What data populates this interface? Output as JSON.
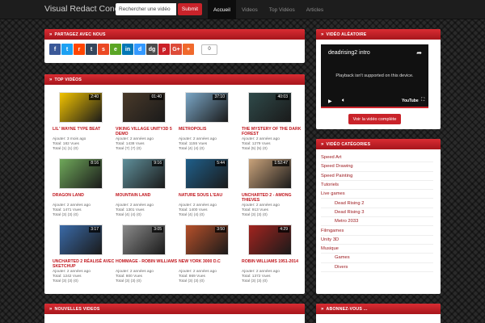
{
  "header": {
    "brand": "Visual Redact Concept",
    "search_placeholder": "Rechercher une vidéo",
    "submit_label": "Submit",
    "nav": [
      {
        "label": "Accueil",
        "active": true
      },
      {
        "label": "Videos",
        "active": false
      },
      {
        "label": "Top Vidéos",
        "active": false
      },
      {
        "label": "Articles",
        "active": false
      }
    ]
  },
  "share_panel": {
    "title": "Partagez avec nous",
    "buttons": [
      {
        "icon": "facebook-icon",
        "glyph": "f",
        "color": "#3b5998"
      },
      {
        "icon": "twitter-icon",
        "glyph": "t",
        "color": "#1da1f2"
      },
      {
        "icon": "reddit-icon",
        "glyph": "r",
        "color": "#ff4500"
      },
      {
        "icon": "tumblr-icon",
        "glyph": "t",
        "color": "#35465c"
      },
      {
        "icon": "stumbleupon-icon",
        "glyph": "s",
        "color": "#eb4924"
      },
      {
        "icon": "evernote-icon",
        "glyph": "e",
        "color": "#5ba525"
      },
      {
        "icon": "linkedin-icon",
        "glyph": "in",
        "color": "#0077b5"
      },
      {
        "icon": "delicious-icon",
        "glyph": "d",
        "color": "#3399ff"
      },
      {
        "icon": "digg-icon",
        "glyph": "dg",
        "color": "#4c4c4c"
      },
      {
        "icon": "pinterest-icon",
        "glyph": "p",
        "color": "#cb2027"
      },
      {
        "icon": "googleplus-icon",
        "glyph": "G+",
        "color": "#dd4b39"
      },
      {
        "icon": "more-share-icon",
        "glyph": "+",
        "color": "#f0692c"
      }
    ],
    "count": "0"
  },
  "top_videos": {
    "title": "Top Vidéos",
    "videos": [
      {
        "title": "LIL' WAYNE TYPE BEAT",
        "duration": "2:40",
        "added": "Ajouter: 3 mois ago",
        "total": "Total: 182 Vues",
        "votes": "Total (1) (1) (0)",
        "thumb": "#f2c300"
      },
      {
        "title": "VIKING VILLAGE UNITY3D 5 DEMO",
        "duration": "01:40",
        "added": "Ajouter: 2 années ago",
        "total": "Total: 1438 Vues",
        "votes": "Total (7) (7) (0)",
        "thumb": "#4a3a2a"
      },
      {
        "title": "METROPOLIS",
        "duration": "37:10",
        "added": "Ajouter: 2 années ago",
        "total": "Total: 1155 Vues",
        "votes": "Total (4) (4) (0)",
        "thumb": "#7aa6c6"
      },
      {
        "title": "THE MYSTERY OF THE DARK FOREST",
        "duration": "40:03",
        "added": "Ajouter: 2 années ago",
        "total": "Total: 1279 Vues",
        "votes": "Total (5) (5) (0)",
        "thumb": "#2f4a4a"
      },
      {
        "title": "DRAGON LAND",
        "duration": "8:16",
        "added": "Ajouter: 2 années ago",
        "total": "Total: 1471 Vues",
        "votes": "Total (3) (3) (0)",
        "thumb": "#6fa85a"
      },
      {
        "title": "MOUNTAIN LAND",
        "duration": "9:16",
        "added": "Ajouter: 2 années ago",
        "total": "Total: 1301 Vues",
        "votes": "Total (4) (4) (0)",
        "thumb": "#5f8f9a"
      },
      {
        "title": "NATURE SOUS L'EAU",
        "duration": "5:44",
        "added": "Ajouter: 2 années ago",
        "total": "Total: 1400 Vues",
        "votes": "Total (4) (4) (0)",
        "thumb": "#1f5f8a"
      },
      {
        "title": "UNCHARTED 2 - AMONG THIEVES",
        "duration": "1:52:47",
        "added": "Ajouter: 2 années ago",
        "total": "Total: 913 Vues",
        "votes": "Total (3) (3) (0)",
        "thumb": "#c9a27a"
      },
      {
        "title": "UNCHARTED 2 RÉALISÉ AVEC SKETCHUP",
        "duration": "3:17",
        "added": "Ajouter: 2 années ago",
        "total": "Total: 1242 Vues",
        "votes": "Total (3) (3) (0)",
        "thumb": "#3a6aa8"
      },
      {
        "title": "HOMMAGE - ROBIN WILLIAMS",
        "duration": "3:05",
        "added": "Ajouter: 2 années ago",
        "total": "Total: 800 Vues",
        "votes": "Total (3) (3) (0)",
        "thumb": "#8a8a8a"
      },
      {
        "title": "NEW YORK 3000 D.C",
        "duration": "3:50",
        "added": "Ajouter: 2 années ago",
        "total": "Total: 869 Vues",
        "votes": "Total (3) (3) (0)",
        "thumb": "#b6502a"
      },
      {
        "title": "ROBIN WILLIAMS 1951-2014",
        "duration": "4:29",
        "added": "Ajouter: 2 années ago",
        "total": "Total: 1372 Vues",
        "votes": "Total (3) (3) (0)",
        "thumb": "#a2241f"
      }
    ]
  },
  "new_videos": {
    "title": "Nouvelles Videos"
  },
  "random_video": {
    "title": "Vidéo aléatoire",
    "player_title": "deadrising2 intro",
    "message": "Playback isn't supported on this device.",
    "yt_label": "YouTube",
    "button_label": "Voir la vidéo complète"
  },
  "categories": {
    "title": "Vidéo Catégories",
    "items": [
      {
        "label": "Speed Art",
        "level": 0
      },
      {
        "label": "Speed Drawing",
        "level": 0
      },
      {
        "label": "Speed Painting",
        "level": 0
      },
      {
        "label": "Tutoriels",
        "level": 0
      },
      {
        "label": "Live games",
        "level": 0
      },
      {
        "label": "Dead Rising 2",
        "level": 1
      },
      {
        "label": "Dead Rising 3",
        "level": 1
      },
      {
        "label": "Metro 2033",
        "level": 1
      },
      {
        "label": "Filmgames",
        "level": 0
      },
      {
        "label": "Unity 3D",
        "level": 0
      },
      {
        "label": "Musique",
        "level": 0
      },
      {
        "label": "Games",
        "level": 1
      },
      {
        "label": "Divers",
        "level": 1
      }
    ]
  },
  "subscribe": {
    "title": "Abonnez-vous ..."
  }
}
